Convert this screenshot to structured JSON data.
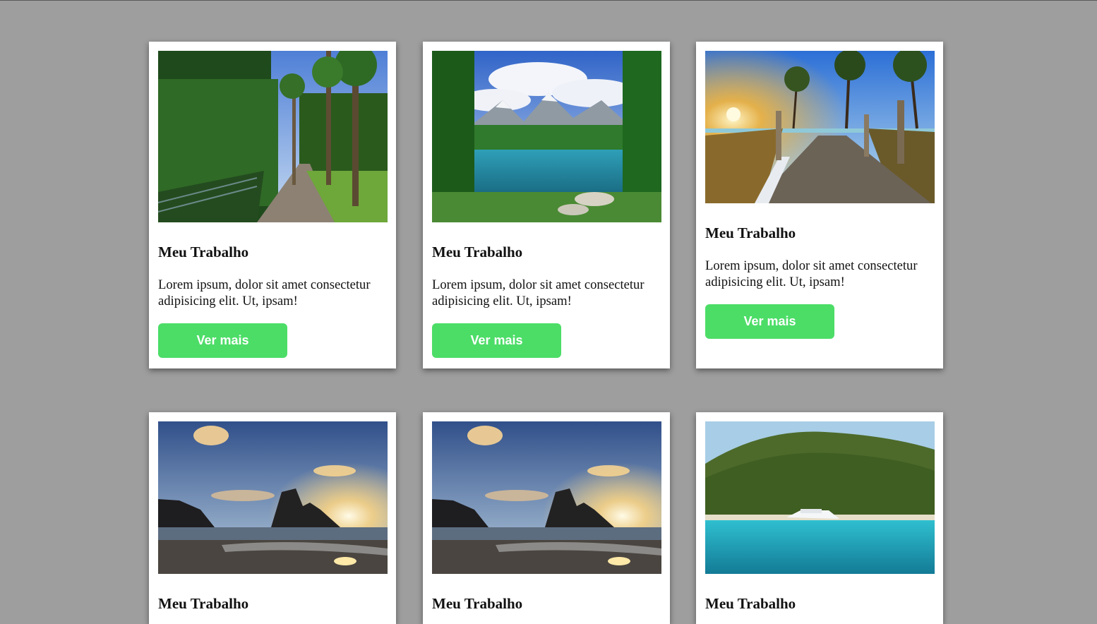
{
  "cards": [
    {
      "title": "Meu Trabalho",
      "text": "Lorem ipsum, dolor sit amet consectetur adipisicing elit. Ut, ipsam!",
      "button": "Ver mais",
      "image": "palm-tree-path-photo"
    },
    {
      "title": "Meu Trabalho",
      "text": "Lorem ipsum, dolor sit amet consectetur adipisicing elit. Ut, ipsam!",
      "button": "Ver mais",
      "image": "mountain-lake-photo"
    },
    {
      "title": "Meu Trabalho",
      "text": "Lorem ipsum, dolor sit amet consectetur adipisicing elit. Ut, ipsam!",
      "button": "Ver mais",
      "image": "beach-boardwalk-sunset-photo"
    },
    {
      "title": "Meu Trabalho",
      "image": "beach-rock-sunset-photo"
    },
    {
      "title": "Meu Trabalho",
      "image": "beach-rock-sunset-photo"
    },
    {
      "title": "Meu Trabalho",
      "image": "tropical-island-boat-photo"
    }
  ],
  "colors": {
    "background": "#9e9e9e",
    "card": "#ffffff",
    "button": "#4cdd67",
    "button_text": "#ffffff"
  }
}
